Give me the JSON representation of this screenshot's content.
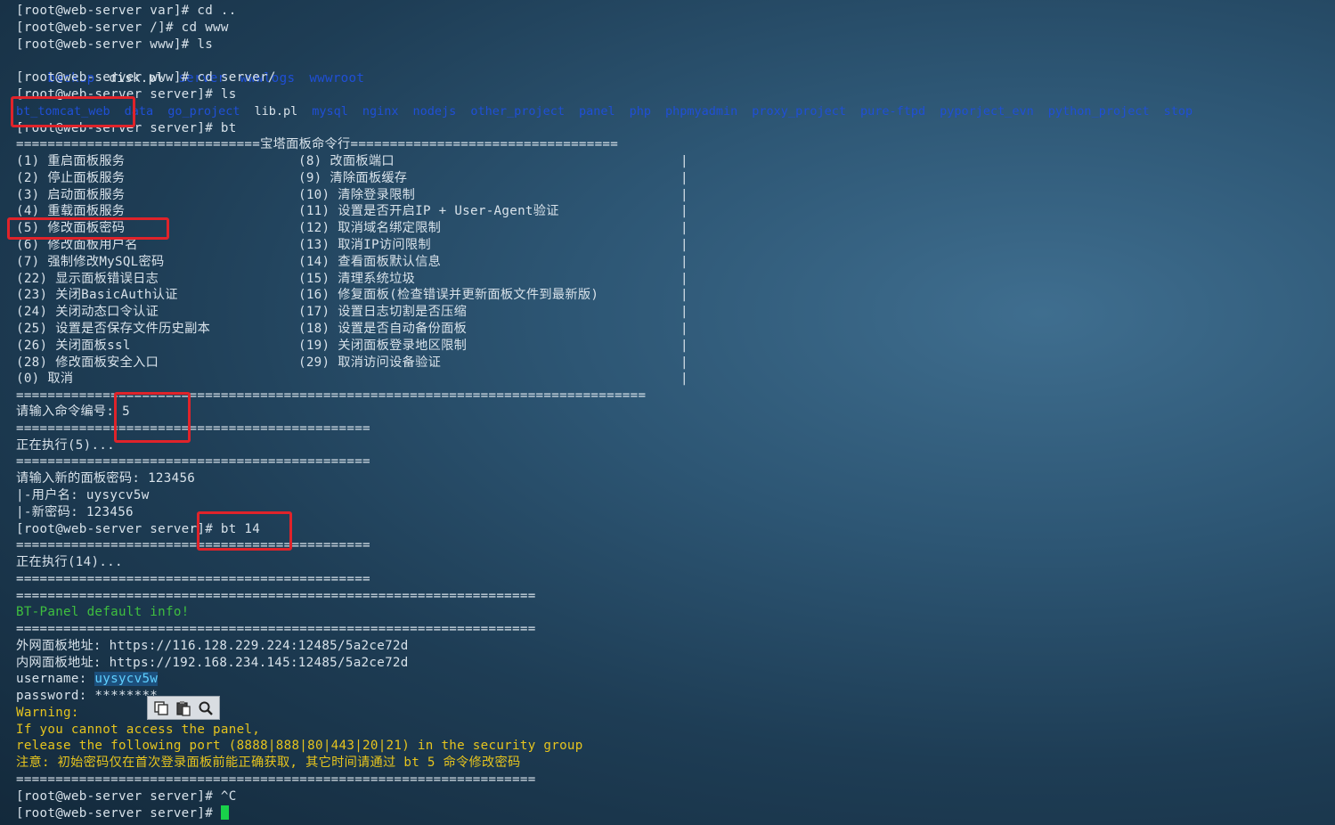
{
  "terminal": {
    "lines": {
      "cd_up": "[root@web-server var]# cd ..",
      "cd_www": "[root@web-server /]# cd www",
      "ls_www": "[root@web-server www]# ls",
      "cd_server": "[root@web-server www]# cd server/",
      "ls_server": "[root@web-server server]# ls",
      "bt": "[root@web-server server]# bt",
      "menu_top": "===============================宝塔面板命令行==================================",
      "menu_bottom": "================================================================================",
      "prompt_input": "请输入命令编号: 5",
      "rule_short": "=============================================",
      "executing_5": "正在执行(5)...",
      "new_password": "请输入新的面板密码: 123456",
      "user_result": "|-用户名: uysycv5w",
      "pass_result": "|-新密码: 123456",
      "bt14": "[root@web-server server]# bt 14",
      "executing_14": "正在执行(14)...",
      "rule_long": "==================================================================",
      "default_info": "BT-Panel default info!",
      "outer_url": "外网面板地址: https://116.128.229.224:12485/5a2ce72d",
      "inner_url": "内网面板地址: https://192.168.234.145:12485/5a2ce72d",
      "username_label": "username: ",
      "username_value": "uysycv5w",
      "password_line": "password: ********",
      "warning": "Warning:",
      "warn1": "If you cannot access the panel,",
      "warn2": "release the following port (8888|888|80|443|20|21) in the security group",
      "note": "注意: 初始密码仅在首次登录面板前能正确获取, 其它时间请通过 bt 5 命令修改密码",
      "ctrl_c": "[root@web-server server]# ^C",
      "final_prompt": "[root@web-server server]# "
    },
    "www_listing": {
      "backup": "backup",
      "disk": "disk.pl",
      "server": "server",
      "wwwlogs": "wwwlogs",
      "wwwroot": "wwwroot"
    },
    "server_listing": [
      "bt_tomcat_web",
      "data",
      "go_project",
      "lib.pl",
      "mysql",
      "nginx",
      "nodejs",
      "other_project",
      "panel",
      "php",
      "phpmyadmin",
      "proxy_project",
      "pure-ftpd",
      "pyporject_evn",
      "python_project",
      "stop"
    ],
    "menu": [
      {
        "l": "(1) 重启面板服务",
        "r": "(8) 改面板端口"
      },
      {
        "l": "(2) 停止面板服务",
        "r": "(9) 清除面板缓存"
      },
      {
        "l": "(3) 启动面板服务",
        "r": "(10) 清除登录限制"
      },
      {
        "l": "(4) 重载面板服务",
        "r": "(11) 设置是否开启IP + User-Agent验证"
      },
      {
        "l": "(5) 修改面板密码",
        "r": "(12) 取消域名绑定限制"
      },
      {
        "l": "(6) 修改面板用户名",
        "r": "(13) 取消IP访问限制"
      },
      {
        "l": "(7) 强制修改MySQL密码",
        "r": "(14) 查看面板默认信息"
      },
      {
        "l": "(22) 显示面板错误日志",
        "r": "(15) 清理系统垃圾"
      },
      {
        "l": "(23) 关闭BasicAuth认证",
        "r": "(16) 修复面板(检查错误并更新面板文件到最新版)"
      },
      {
        "l": "(24) 关闭动态口令认证",
        "r": "(17) 设置日志切割是否压缩"
      },
      {
        "l": "(25) 设置是否保存文件历史副本",
        "r": "(18) 设置是否自动备份面板"
      },
      {
        "l": "(26) 关闭面板ssl",
        "r": "(19) 关闭面板登录地区限制"
      },
      {
        "l": "(28) 修改面板安全入口",
        "r": "(29) 取消访问设备验证"
      },
      {
        "l": "(0) 取消",
        "r": ""
      }
    ],
    "border_char": "|"
  },
  "toolbar": {
    "copy_icon": "copy-icon",
    "paste_icon": "paste-icon",
    "search_icon": "search-icon"
  },
  "colors": {
    "directory": "#1f4fd6",
    "info_green": "#3fbf3f",
    "warning_yellow": "#e6c41e",
    "annotation_red": "#e0232a",
    "cursor_green": "#19d14a"
  }
}
